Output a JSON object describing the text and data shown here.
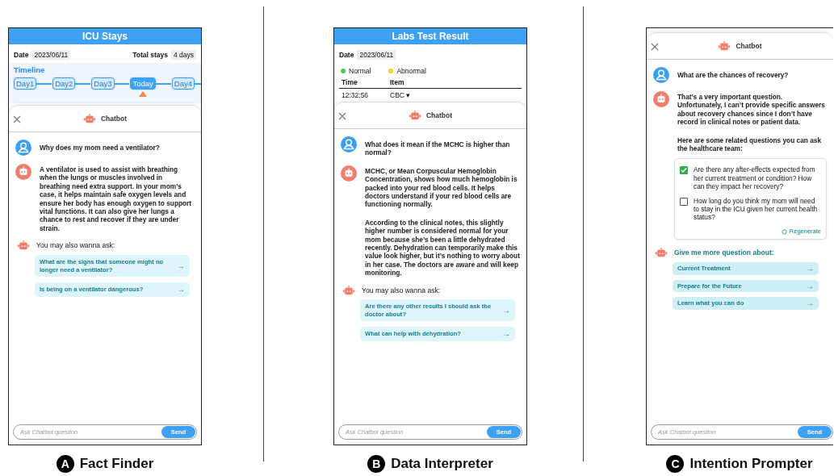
{
  "panels": [
    {
      "kind": "icu",
      "caption": {
        "letter": "A",
        "title": "Fact Finder"
      },
      "header": {
        "title": "ICU Stays",
        "date_label": "Date",
        "date": "2023/06/11",
        "stays_label": "Total stays",
        "stays": "4 days",
        "timeline_label": "Timeline",
        "days": [
          {
            "label": "Day1",
            "selected": false
          },
          {
            "label": "Day2",
            "selected": false
          },
          {
            "label": "Day3",
            "selected": false
          },
          {
            "label": "Today",
            "selected": true
          },
          {
            "label": "Day4",
            "selected": false
          }
        ]
      },
      "chat": {
        "title": "Chatbot",
        "messages": [
          {
            "kind": "user",
            "text": "Why does my mom need a ventilator?"
          },
          {
            "kind": "bot",
            "paragraphs": [
              "A ventilator is used to assist with breathing when the lungs or muscles involved in breathing need extra support. In your mom’s case, it helps maintain safe oxygen levels and ensure her body has enough oxygen to support vital functions. It can also give her lungs a chance to rest and recover if they are under strain."
            ]
          },
          {
            "kind": "suggestions",
            "label": "You may also wanna ask:",
            "items": [
              {
                "text": "What are the signs that someone might no longer need a ventilator?",
                "arrow": "→"
              },
              {
                "text": "Is being on a ventilator dangerous?",
                "arrow": "→"
              }
            ]
          }
        ],
        "placeholder": "Ask Chatbot question",
        "send": "Send"
      }
    },
    {
      "kind": "labs",
      "caption": {
        "letter": "B",
        "title": "Data Interpreter"
      },
      "header": {
        "title": "Labs Test Result",
        "date_label": "Date",
        "date": "2023/06/11",
        "legend": [
          {
            "label": "Normal",
            "color": "#3ec95c"
          },
          {
            "label": "Abnormal",
            "color": "#f6d11c"
          }
        ],
        "columns": [
          "Time",
          "Item"
        ],
        "row": [
          "12:32:56",
          "CBC ▾"
        ]
      },
      "chat": {
        "title": "Chatbot",
        "messages": [
          {
            "kind": "user",
            "text": "What does it mean if the MCHC is higher than normal?"
          },
          {
            "kind": "bot",
            "paragraphs": [
              "MCHC, or Mean Corpuscular Hemoglobin Concentration, shows how much hemoglobin is packed into your red blood cells. It helps doctors understand if your red blood cells are functioning normally.",
              "According to the clinical notes, this slightly higher number is considered normal for your mom because she’s been a little dehydrated recently. Dehydration can temporarily make this value look higher, but it’s nothing to worry about in her case. The doctors are aware and will keep monitoring."
            ]
          },
          {
            "kind": "suggestions",
            "label": "You may also wanna ask:",
            "items": [
              {
                "text": "Are there any other results I should ask the doctor about?",
                "arrow": "→"
              },
              {
                "text": "What can help with dehydration?",
                "arrow": "→"
              }
            ]
          }
        ],
        "placeholder": "Ask Chatbot question",
        "send": "Send"
      }
    },
    {
      "kind": "chat",
      "caption": {
        "letter": "C",
        "title": "Intention Prompter"
      },
      "chat": {
        "title": "Chatbot",
        "messages": [
          {
            "kind": "user",
            "text": "What are the chances of recovery?"
          },
          {
            "kind": "bot",
            "paragraphs": [
              "That’s a very important question. Unfortunately, I can’t provide specific answers about recovery chances since I don’t have record in clinical notes or patient data.",
              "Here are some related questions you can ask the healthcare team:"
            ]
          },
          {
            "kind": "checklist",
            "items": [
              {
                "text": "Are there any after-effects expected from her current treatment or condition? How can they impact her recovery?",
                "checked": true
              },
              {
                "text": "How long do you think my mom will need to stay in the ICU given her current health status?",
                "checked": false
              }
            ],
            "regenerate": "Regenerate"
          },
          {
            "kind": "topics",
            "label": "Give me more question about:",
            "items": [
              {
                "text": "Current Treatment",
                "arrow": "→"
              },
              {
                "text": "Prepare for the Future",
                "arrow": "→"
              },
              {
                "text": "Learn what you can do",
                "arrow": "→"
              }
            ]
          }
        ],
        "placeholder": "Ask Chatbot question",
        "send": "Send"
      }
    }
  ]
}
